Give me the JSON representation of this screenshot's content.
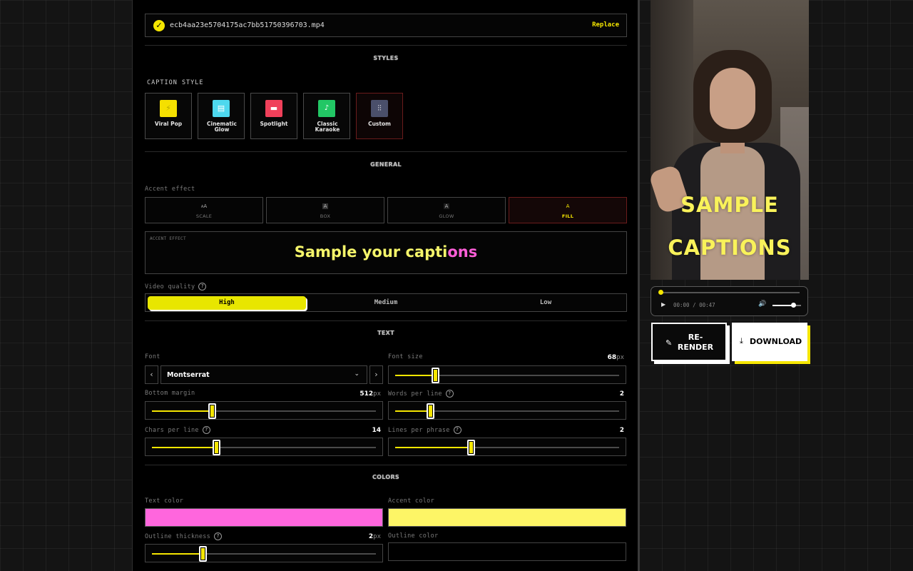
{
  "file": {
    "name": "ecb4aa23e5704175ac7bb51750396703.mp4",
    "replace_label": "Replace"
  },
  "sections": {
    "styles": "STYLES",
    "general": "GENERAL",
    "text": "TEXT",
    "colors": "COLORS"
  },
  "caption_style": {
    "label": "CAPTION STYLE",
    "options": [
      {
        "name": "Viral Pop",
        "color": "#f5e000",
        "icon": "lightning-icon",
        "glyph": "⚡"
      },
      {
        "name": "Cinematic Glow",
        "color": "#4dd8ee",
        "icon": "film-icon",
        "glyph": "▤"
      },
      {
        "name": "Spotlight",
        "color": "#f0405a",
        "icon": "spotlight-icon",
        "glyph": "▬"
      },
      {
        "name": "Classic Karaoke",
        "color": "#22c765",
        "icon": "microphone-icon",
        "glyph": "🎤"
      },
      {
        "name": "Custom",
        "color": "#4a4f6a",
        "icon": "sliders-icon",
        "glyph": "⫶",
        "selected": true
      }
    ]
  },
  "accent_effect": {
    "label": "Accent effect",
    "options": [
      {
        "name": "SCALE",
        "glyph": "ᴬA"
      },
      {
        "name": "BOX",
        "glyph": "A"
      },
      {
        "name": "GLOW",
        "glyph": "A"
      },
      {
        "name": "FILL",
        "glyph": "A",
        "selected": true
      }
    ],
    "preview_label": "ACCENT EFFECT",
    "preview_text_main": "Sample your capti",
    "preview_text_accent": "ons"
  },
  "video_quality": {
    "label": "Video quality",
    "options": [
      "High",
      "Medium",
      "Low"
    ],
    "selected": "High"
  },
  "text": {
    "font": {
      "label": "Font",
      "value": "Montserrat",
      "prev": "‹",
      "next": "›"
    },
    "font_size": {
      "label": "Font size",
      "value": "68",
      "unit": "px",
      "fraction": 0.18
    },
    "bottom_margin": {
      "label": "Bottom margin",
      "value": "512",
      "unit": "px",
      "fraction": 0.27
    },
    "words_per_line": {
      "label": "Words per line",
      "value": "2",
      "fraction": 0.16
    },
    "chars_per_line": {
      "label": "Chars per line",
      "value": "14",
      "fraction": 0.29
    },
    "lines_per_phrase": {
      "label": "Lines per phrase",
      "value": "2",
      "fraction": 0.34
    }
  },
  "colors": {
    "text_color": {
      "label": "Text color",
      "value": "#ff66dd"
    },
    "accent_color": {
      "label": "Accent color",
      "value": "#fdf566"
    },
    "outline_thickness": {
      "label": "Outline thickness",
      "value": "2",
      "unit": "px",
      "fraction": 0.23
    },
    "outline_color": {
      "label": "Outline color",
      "value": "#000000"
    }
  },
  "preview": {
    "caption_line1": "SAMPLE",
    "caption_line2": "CAPTIONS"
  },
  "player": {
    "time": "00:00 / 00:47",
    "progress": 0.0,
    "volume": 0.7
  },
  "actions": {
    "rerender": "RE-\nRENDER",
    "download": "DOWNLOAD"
  }
}
